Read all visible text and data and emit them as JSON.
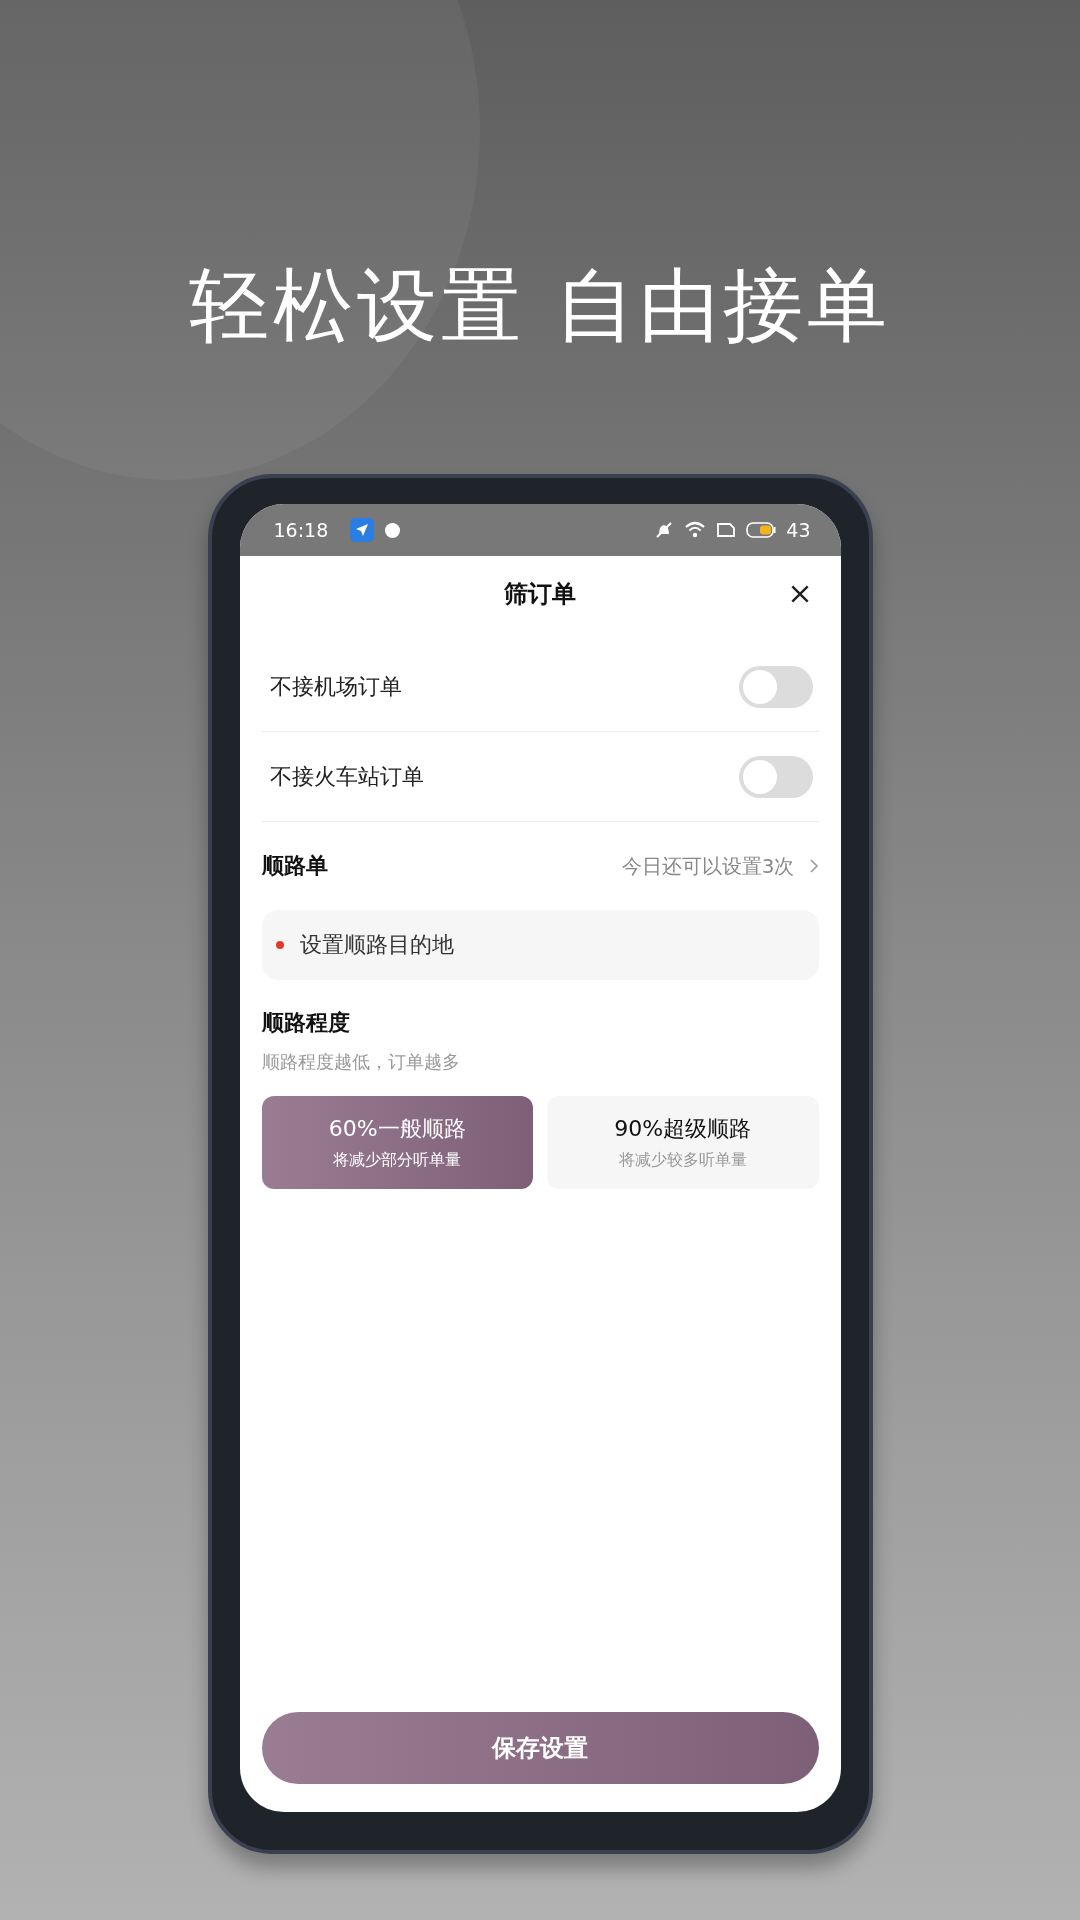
{
  "headline": "轻松设置 自由接单",
  "status_bar": {
    "time": "16:18",
    "battery": "43"
  },
  "sheet": {
    "title": "筛订单"
  },
  "toggles": [
    {
      "label": "不接机场订单",
      "on": false
    },
    {
      "label": "不接火车站订单",
      "on": false
    }
  ],
  "route_order": {
    "title": "顺路单",
    "remaining": "今日还可以设置3次",
    "destination": {
      "placeholder": "设置顺路目的地"
    }
  },
  "route_degree": {
    "title": "顺路程度",
    "hint": "顺路程度越低，订单越多",
    "options": [
      {
        "label": "60%一般顺路",
        "note": "将减少部分听单量",
        "selected": true
      },
      {
        "label": "90%超级顺路",
        "note": "将减少较多听单量",
        "selected": false
      }
    ]
  },
  "save_button": "保存设置"
}
